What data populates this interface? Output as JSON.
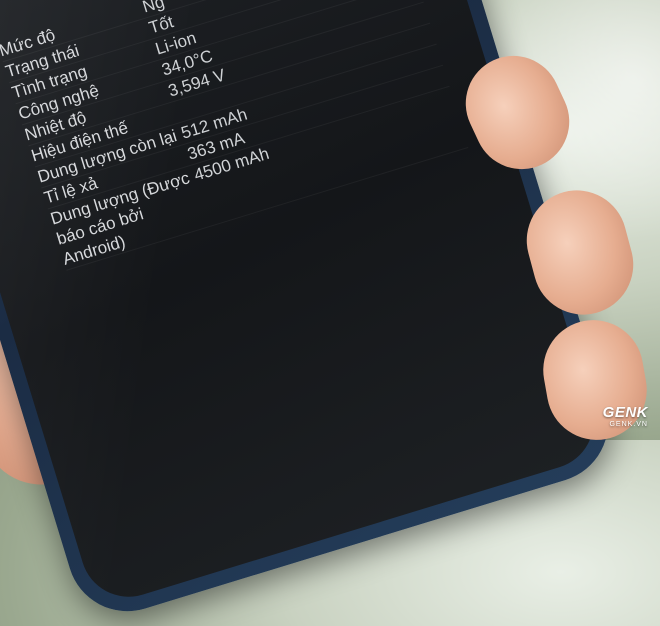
{
  "battery_info": {
    "rows": [
      {
        "label": "Mức độ",
        "value": "Ng"
      },
      {
        "label": "Trạng thái",
        "value": "Tốt"
      },
      {
        "label": "Tình trạng",
        "value": "Li-ion"
      },
      {
        "label": "Công nghệ",
        "value": "34,0°C"
      },
      {
        "label": "Nhiệt độ",
        "value": "3,594 V"
      },
      {
        "label": "Hiệu điện thế",
        "value": ""
      },
      {
        "label": "Dung lượng còn lại",
        "value": "512 mAh"
      },
      {
        "label": "Tỉ lệ xả",
        "value": "363 mA"
      },
      {
        "label": "Dung lượng (Được báo cáo bởi Android)",
        "value": "4500 mAh"
      }
    ]
  },
  "watermark": {
    "logo": "GENK",
    "sub": "GENK.VN"
  }
}
